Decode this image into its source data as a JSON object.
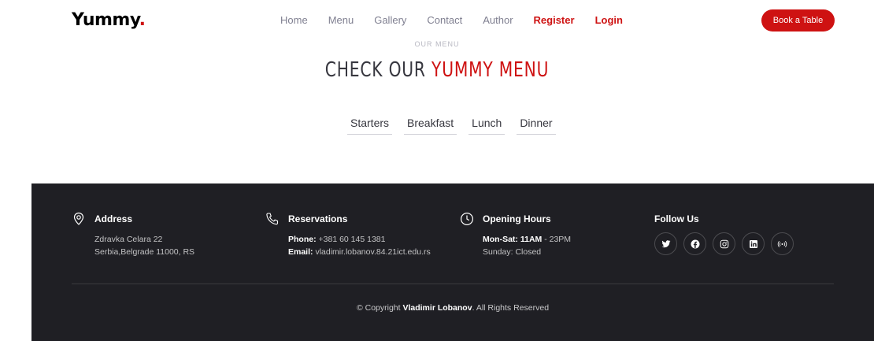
{
  "header": {
    "logo_text": "Yummy",
    "logo_dot": ".",
    "nav": [
      {
        "label": "Home",
        "accent": false
      },
      {
        "label": "Menu",
        "accent": false
      },
      {
        "label": "Gallery",
        "accent": false
      },
      {
        "label": "Contact",
        "accent": false
      },
      {
        "label": "Author",
        "accent": false
      },
      {
        "label": "Register",
        "accent": true
      },
      {
        "label": "Login",
        "accent": true
      }
    ],
    "book_label": "Book a Table"
  },
  "menu_section": {
    "subtitle": "Our Menu",
    "title_part1": "Check Our",
    "title_part2": "Yummy Menu",
    "tabs": [
      "Starters",
      "Breakfast",
      "Lunch",
      "Dinner"
    ]
  },
  "footer": {
    "address": {
      "heading": "Address",
      "line1": "Zdravka Celara 22",
      "line2": "Serbia,Belgrade 11000, RS"
    },
    "reservations": {
      "heading": "Reservations",
      "phone_label": "Phone:",
      "phone": "+381 60 145 1381",
      "email_label": "Email:",
      "email": "vladimir.lobanov.84.21ict.edu.rs"
    },
    "hours": {
      "heading": "Opening Hours",
      "days_label": "Mon-Sat:",
      "open": "11AM",
      "close": "- 23PM",
      "sunday": "Sunday: Closed"
    },
    "follow": {
      "heading": "Follow Us",
      "icons": [
        "twitter-icon",
        "facebook-icon",
        "instagram-icon",
        "linkedin-icon",
        "broadcast-icon"
      ]
    },
    "copyright_prefix": "© Copyright",
    "copyright_name": "Vladimir Lobanov",
    "copyright_suffix": ". All Rights Reserved"
  },
  "colors": {
    "accent": "#ce1212",
    "footer_bg": "#1f1f24"
  }
}
